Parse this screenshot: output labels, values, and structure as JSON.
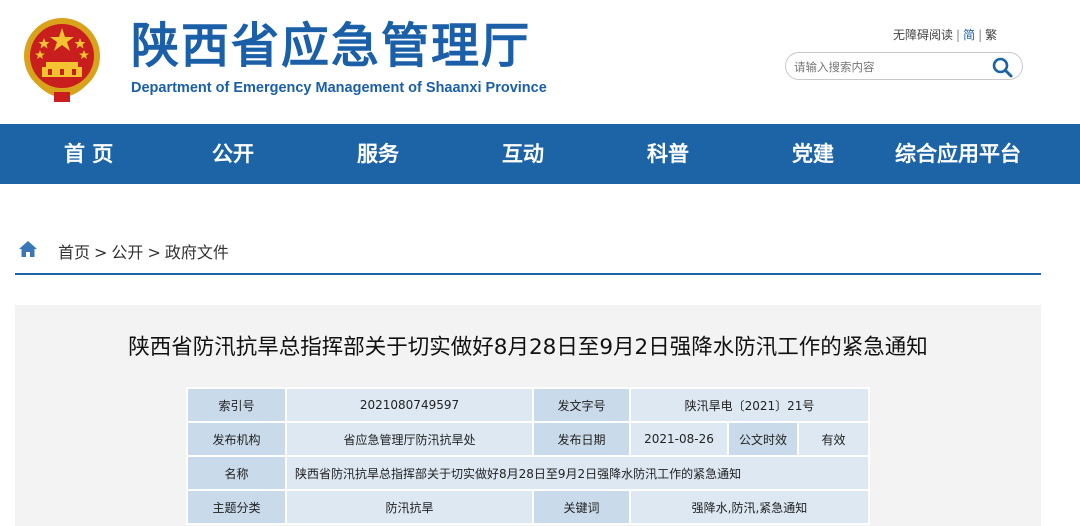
{
  "header": {
    "title": "陕西省应急管理厅",
    "subtitle": "Department of Emergency Management of Shaanxi Province",
    "accessibility_label": "无障碍阅读",
    "simplified_label": "简",
    "traditional_label": "繁",
    "search": {
      "placeholder": "请输入搜索内容",
      "value": ""
    }
  },
  "nav": {
    "items": [
      {
        "label": "首 页"
      },
      {
        "label": "公开"
      },
      {
        "label": "服务"
      },
      {
        "label": "互动"
      },
      {
        "label": "科普"
      },
      {
        "label": "党建"
      },
      {
        "label": "综合应用平台"
      }
    ]
  },
  "breadcrumb": {
    "items": [
      "首页",
      "公开",
      "政府文件"
    ],
    "separator": ">"
  },
  "article": {
    "title": "陕西省防汛抗旱总指挥部关于切实做好8月28日至9月2日强降水防汛工作的紧急通知",
    "meta": {
      "index_label": "索引号",
      "index_value": "2021080749597",
      "doc_no_label": "发文字号",
      "doc_no_value": "陕汛旱电〔2021〕21号",
      "publisher_label": "发布机构",
      "publisher_value": "省应急管理厅防汛抗旱处",
      "date_label": "发布日期",
      "date_value": "2021-08-26",
      "validity_label": "公文时效",
      "validity_value": "有效",
      "name_label": "名称",
      "name_value": "陕西省防汛抗旱总指挥部关于切实做好8月28日至9月2日强降水防汛工作的紧急通知",
      "topic_label": "主题分类",
      "topic_value": "防汛抗旱",
      "keywords_label": "关键词",
      "keywords_value": "强降水,防汛,紧急通知"
    }
  },
  "colors": {
    "brand_blue": "#1d64a7",
    "title_blue": "#1a5fa8",
    "table_label_bg": "#c9daea",
    "table_value_bg": "#dde8f2",
    "article_bg": "#f3f3f3"
  },
  "icons": [
    "national-emblem-icon",
    "search-icon",
    "home-icon"
  ]
}
